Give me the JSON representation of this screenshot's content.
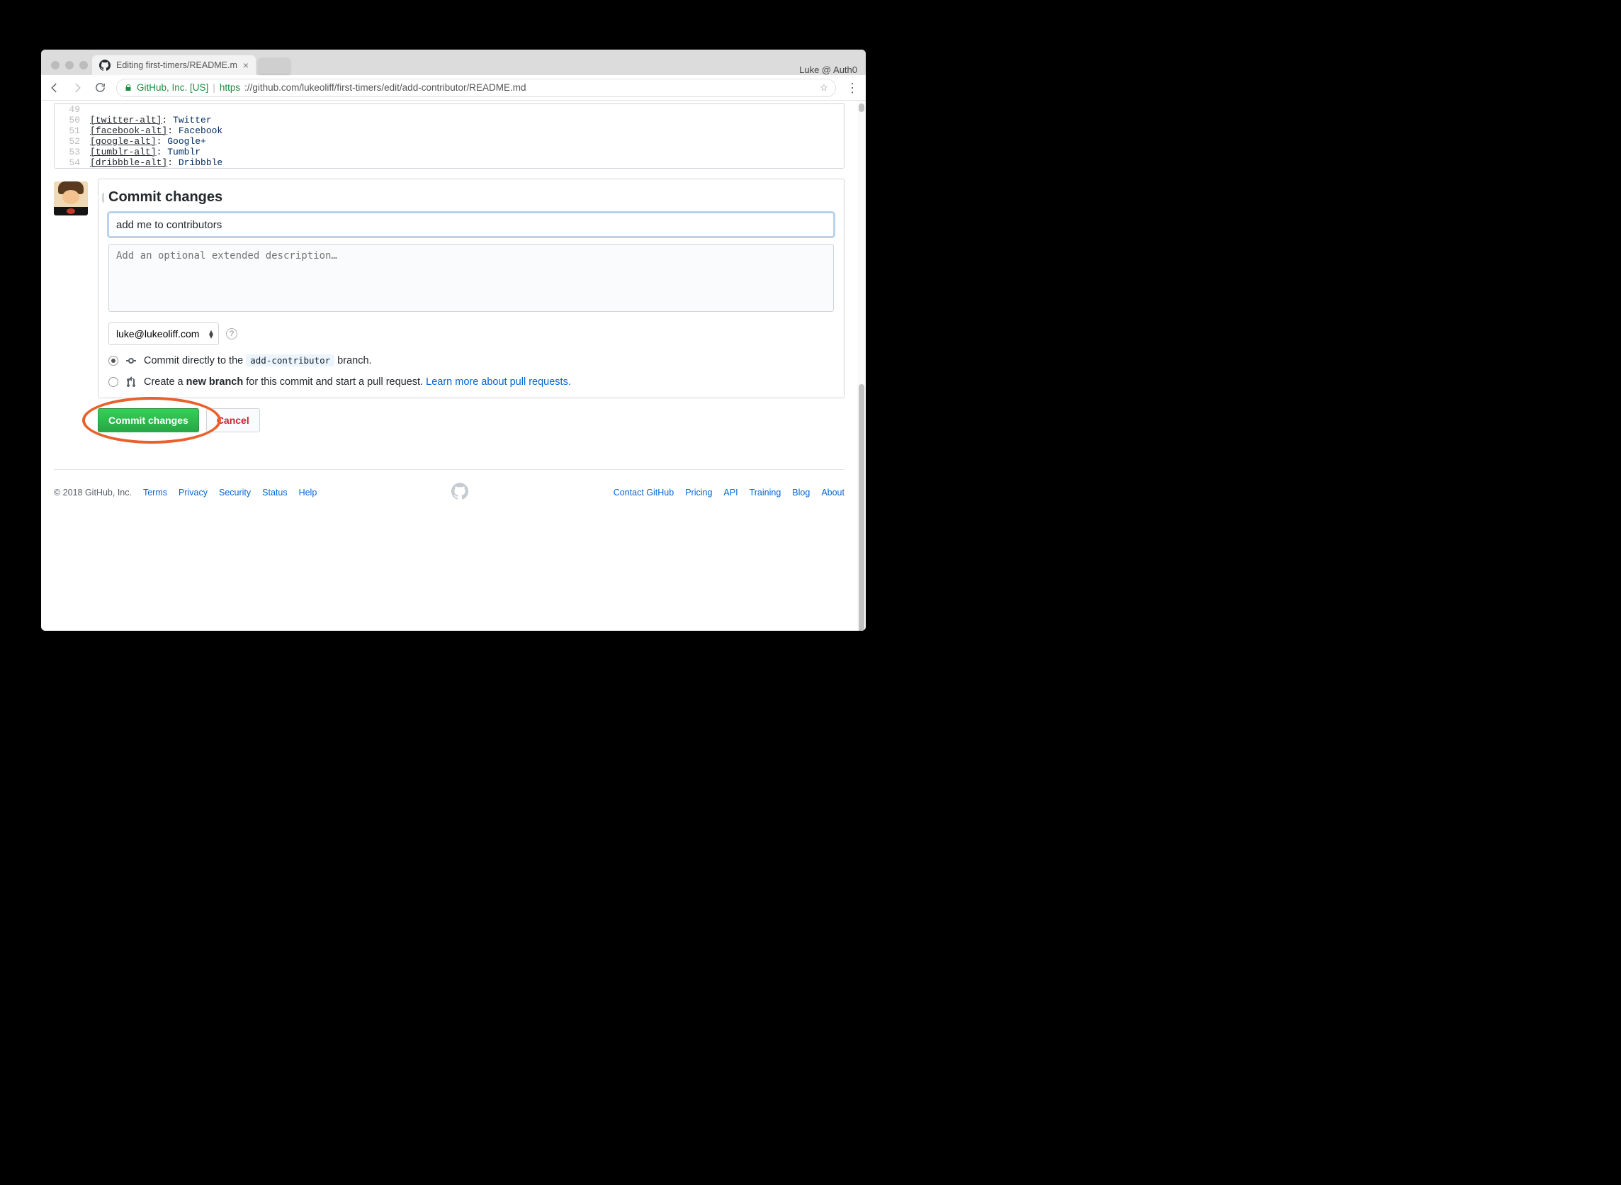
{
  "browser": {
    "profile_label": "Luke @ Auth0",
    "tab_title": "Editing first-timers/README.m",
    "url_org": "GitHub, Inc. [US]",
    "url_scheme": "https",
    "url_rest": "://github.com/lukeoliff/first-timers/edit/add-contributor/README.md"
  },
  "editor": {
    "lines": [
      {
        "num": "49",
        "ref": "",
        "val": ""
      },
      {
        "num": "50",
        "ref": "[twitter-alt]",
        "val": "Twitter"
      },
      {
        "num": "51",
        "ref": "[facebook-alt]",
        "val": "Facebook"
      },
      {
        "num": "52",
        "ref": "[google-alt]",
        "val": "Google+"
      },
      {
        "num": "53",
        "ref": "[tumblr-alt]",
        "val": "Tumblr"
      },
      {
        "num": "54",
        "ref": "[dribbble-alt]",
        "val": "Dribbble"
      }
    ]
  },
  "commit": {
    "heading": "Commit changes",
    "summary_value": "add me to contributors",
    "description_placeholder": "Add an optional extended description…",
    "email": "luke@lukeoliff.com",
    "radio_direct_pre": "Commit directly to the ",
    "radio_direct_branch": "add-contributor",
    "radio_direct_post": " branch.",
    "radio_new_pre": "Create a ",
    "radio_new_bold": "new branch",
    "radio_new_post": " for this commit and start a pull request. ",
    "radio_new_link": "Learn more about pull requests.",
    "btn_commit": "Commit changes",
    "btn_cancel": "Cancel"
  },
  "footer": {
    "copyright": "© 2018 GitHub, Inc.",
    "left_links": [
      "Terms",
      "Privacy",
      "Security",
      "Status",
      "Help"
    ],
    "right_links": [
      "Contact GitHub",
      "Pricing",
      "API",
      "Training",
      "Blog",
      "About"
    ]
  }
}
